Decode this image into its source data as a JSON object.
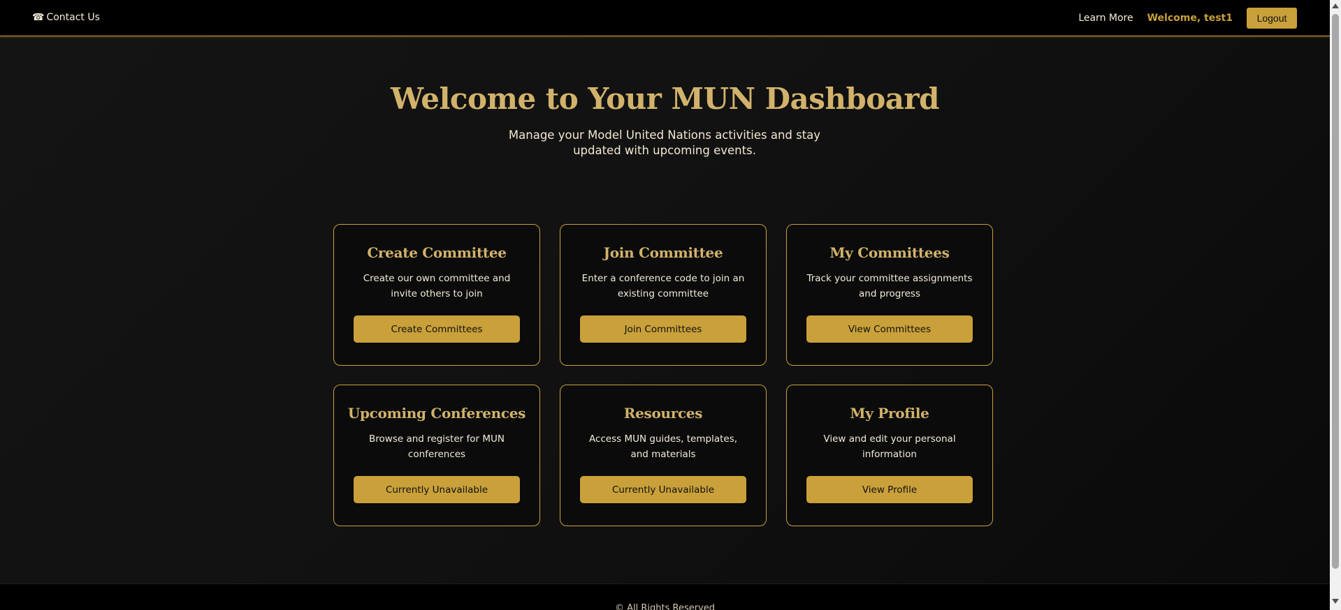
{
  "navbar": {
    "contact_icon": "☎",
    "contact_label": "Contact Us",
    "learn_more": "Learn More",
    "welcome": "Welcome, test1",
    "logout": "Logout"
  },
  "hero": {
    "title": "Welcome to Your MUN Dashboard",
    "subtitle": "Manage your Model United Nations activities and stay updated with upcoming events."
  },
  "cards": [
    {
      "title": "Create Committee",
      "description": "Create our own committee and invite others to join",
      "button": "Create Committees"
    },
    {
      "title": "Join Committee",
      "description": "Enter a conference code to join an existing committee",
      "button": "Join Committees"
    },
    {
      "title": "My Committees",
      "description": "Track your committee assignments and progress",
      "button": "View Committees"
    },
    {
      "title": "Upcoming Conferences",
      "description": "Browse and register for MUN conferences",
      "button": "Currently Unavailable"
    },
    {
      "title": "Resources",
      "description": "Access MUN guides, templates, and materials",
      "button": "Currently Unavailable"
    },
    {
      "title": "My Profile",
      "description": "View and edit your personal information",
      "button": "View Profile"
    }
  ],
  "footer": {
    "text": "© All Rights Reserved"
  },
  "colors": {
    "accent": "#c9a03a",
    "heading": "#d2b26b",
    "background": "#111111"
  }
}
